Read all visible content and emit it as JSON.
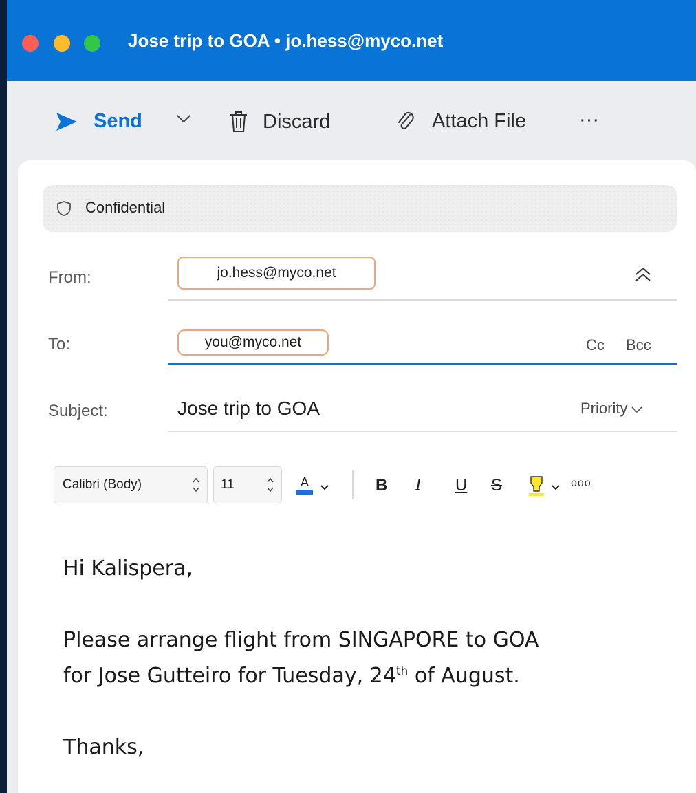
{
  "window": {
    "title": "Jose trip to GOA  •  jo.hess@myco.net",
    "accent": "#0a73d6"
  },
  "toolbar": {
    "send_label": "Send",
    "discard_label": "Discard",
    "attach_label": "Attach File",
    "more_label": "···"
  },
  "sensitivity": {
    "label": "Confidential"
  },
  "header": {
    "from_label": "From:",
    "from_value": "jo.hess@myco.net",
    "to_label": "To:",
    "to_value": "you@myco.net",
    "cc_label": "Cc",
    "bcc_label": "Bcc",
    "subject_label": "Subject:",
    "subject_value": "Jose trip to GOA",
    "priority_label": "Priority"
  },
  "format": {
    "font_name": "Calibri (Body)",
    "font_size": "11",
    "bold": "B",
    "italic": "I",
    "underline": "U",
    "strike": "S",
    "more": "ooo",
    "text_color": "#1f6fd1",
    "highlight_color": "#ffe733"
  },
  "message": {
    "greeting": "Hi Kalispera,",
    "line1": "Please arrange flight from SINGAPORE to GOA",
    "line2_a": "for Jose Gutteiro for Tuesday, 24",
    "line2_sup": "th",
    "line2_b": " of August.",
    "closing": "Thanks,"
  }
}
